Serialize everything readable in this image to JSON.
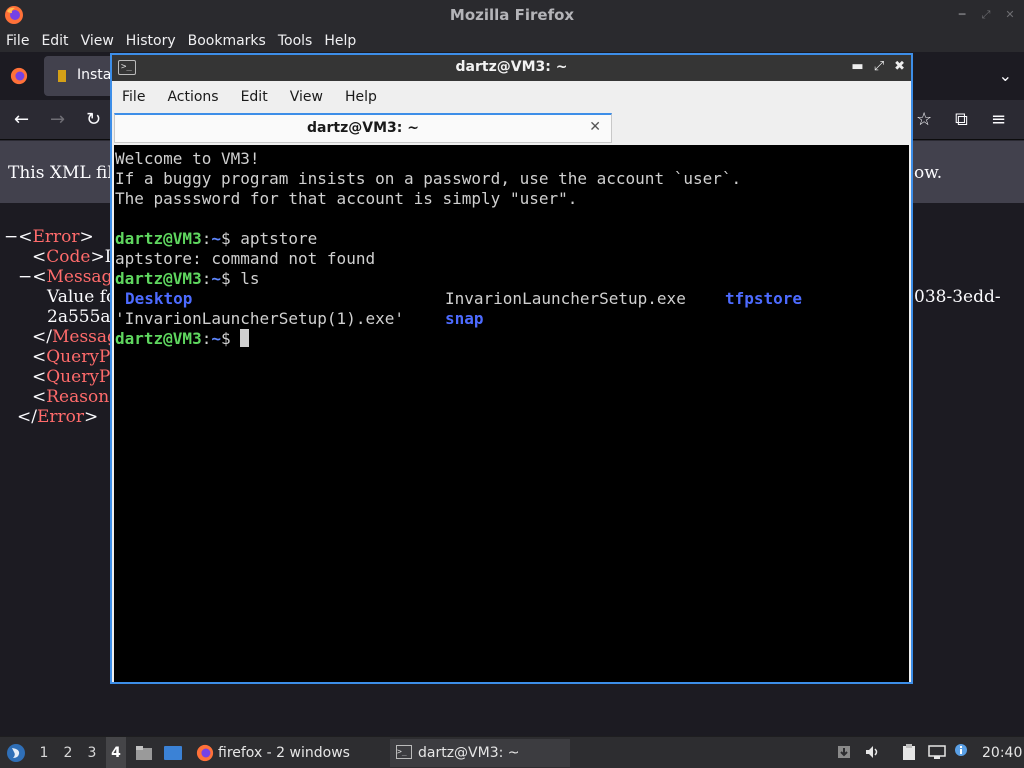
{
  "firefox": {
    "window_title": "Mozilla Firefox",
    "menu": [
      "File",
      "Edit",
      "View",
      "History",
      "Bookmarks",
      "Tools",
      "Help"
    ],
    "tab_label": "Insta",
    "infobar_text": "This XML file",
    "infobar_tail": "ow.",
    "xml": {
      "line_error_open_prefix": "−<",
      "error_tag": "Error",
      "close_gt": ">",
      "code_open": "<",
      "code_tag": "Code",
      "code_value": ">I",
      "message_prefix": "−<",
      "message_tag": "Messag",
      "value_text": "Value fo",
      "value_right": "038-3edd-",
      "value_line2": "2a555a",
      "message_close_prefix": "</",
      "message_close_tag": "Messag",
      "query1_prefix": "<",
      "query1_tag": "QueryP",
      "query2_prefix": "<",
      "query2_tag": "QueryP",
      "reason_prefix": "<",
      "reason_tag": "Reason",
      "error_close_prefix": "</",
      "error_close_tag": "Error",
      "error_close_suffix": ">"
    }
  },
  "terminal": {
    "window_title": "dartz@VM3: ~",
    "menu": [
      "File",
      "Actions",
      "Edit",
      "View",
      "Help"
    ],
    "tab_label": "dartz@VM3: ~",
    "tab_close": "✕",
    "lines": {
      "welcome1": "Welcome to VM3!",
      "welcome2": "If a buggy program insists on a password, use the account `user`.",
      "welcome3": "The passsword for that account is simply \"user\".",
      "prompt_user": "dartz@VM3",
      "prompt_colon": ":",
      "prompt_path": "~",
      "prompt_dollar": "$ ",
      "cmd1": "aptstore",
      "err1": "aptstore: command not found",
      "cmd2": "ls"
    },
    "ls": {
      "desktop": "Desktop",
      "invarion_exe": "InvarionLauncherSetup.exe",
      "tfpstore": "tfpstore",
      "invarion_copy": "'InvarionLauncherSetup(1).exe'",
      "snap": "snap"
    }
  },
  "taskbar": {
    "workspaces": [
      "1",
      "2",
      "3",
      "4"
    ],
    "active_workspace": "4",
    "firefox_task": "firefox - 2 windows",
    "terminal_task": "dartz@VM3: ~",
    "clock": "20:40"
  },
  "colors": {
    "terminal_border": "#3d8ee8",
    "prompt_user": "#5fd75f",
    "prompt_path": "#5f87ff",
    "ls_dir": "#4d6bff",
    "xml_tag": "#ff6b6b"
  }
}
